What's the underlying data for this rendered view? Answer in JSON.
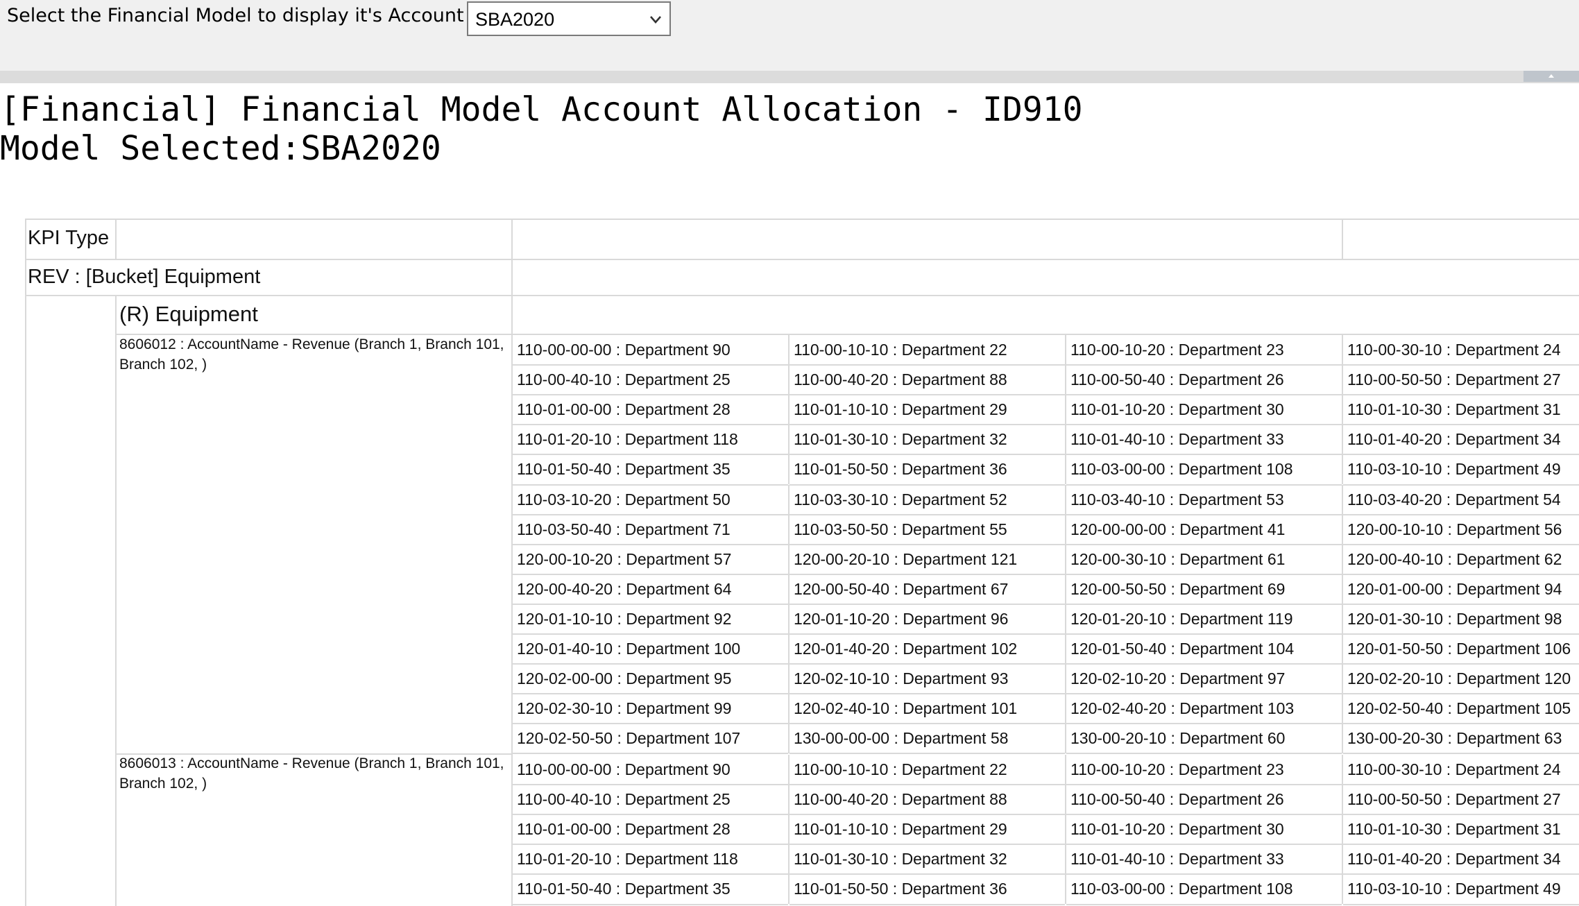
{
  "filter": {
    "label": "Select the Financial Model to display it's Account List",
    "selected": "SBA2020"
  },
  "title": "[Financial] Financial Model Account Allocation - ID910",
  "model_selected": "Model Selected:SBA2020",
  "table": {
    "kpi_label": "KPI Type",
    "bucket": "REV : [Bucket]  Equipment",
    "group": "(R) Equipment",
    "accounts": [
      {
        "name": "8606012 : AccountName - Revenue (Branch 1, Branch 101, Branch 102, )",
        "departments": [
          "110-00-00-00 : Department 90",
          "110-00-10-10 : Department 22",
          "110-00-10-20 : Department 23",
          "110-00-30-10 : Department 24",
          "110-00-40-10 : Department 25",
          "110-00-40-20 : Department 88",
          "110-00-50-40 : Department 26",
          "110-00-50-50 : Department 27",
          "110-01-00-00 : Department 28",
          "110-01-10-10 : Department 29",
          "110-01-10-20 : Department 30",
          "110-01-10-30 : Department 31",
          "110-01-20-10 : Department 118",
          "110-01-30-10 : Department 32",
          "110-01-40-10 : Department 33",
          "110-01-40-20 : Department 34",
          "110-01-50-40 : Department 35",
          "110-01-50-50 : Department 36",
          "110-03-00-00 : Department 108",
          "110-03-10-10 : Department 49",
          "110-03-10-20 : Department 50",
          "110-03-30-10 : Department 52",
          "110-03-40-10 : Department 53",
          "110-03-40-20 : Department 54",
          "110-03-50-40 : Department 71",
          "110-03-50-50 : Department 55",
          "120-00-00-00 : Department 41",
          "120-00-10-10 : Department 56",
          "120-00-10-20 : Department 57",
          "120-00-20-10 : Department 121",
          "120-00-30-10 : Department 61",
          "120-00-40-10 : Department 62",
          "120-00-40-20 : Department 64",
          "120-00-50-40 : Department 67",
          "120-00-50-50 : Department 69",
          "120-01-00-00 : Department 94",
          "120-01-10-10 : Department 92",
          "120-01-10-20 : Department 96",
          "120-01-20-10 : Department 119",
          "120-01-30-10 : Department 98",
          "120-01-40-10 : Department 100",
          "120-01-40-20 : Department 102",
          "120-01-50-40 : Department 104",
          "120-01-50-50 : Department 106",
          "120-02-00-00 : Department 95",
          "120-02-10-10 : Department 93",
          "120-02-10-20 : Department 97",
          "120-02-20-10 : Department 120",
          "120-02-30-10 : Department 99",
          "120-02-40-10 : Department 101",
          "120-02-40-20 : Department 103",
          "120-02-50-40 : Department 105",
          "120-02-50-50 : Department 107",
          "130-00-00-00 : Department 58",
          "130-00-20-10 : Department 60",
          "130-00-20-30 : Department 63"
        ]
      },
      {
        "name": "8606013 : AccountName - Revenue (Branch 1, Branch 101, Branch 102, )",
        "departments": [
          "110-00-00-00 : Department 90",
          "110-00-10-10 : Department 22",
          "110-00-10-20 : Department 23",
          "110-00-30-10 : Department 24",
          "110-00-40-10 : Department 25",
          "110-00-40-20 : Department 88",
          "110-00-50-40 : Department 26",
          "110-00-50-50 : Department 27",
          "110-01-00-00 : Department 28",
          "110-01-10-10 : Department 29",
          "110-01-10-20 : Department 30",
          "110-01-10-30 : Department 31",
          "110-01-20-10 : Department 118",
          "110-01-30-10 : Department 32",
          "110-01-40-10 : Department 33",
          "110-01-40-20 : Department 34",
          "110-01-50-40 : Department 35",
          "110-01-50-50 : Department 36",
          "110-03-00-00 : Department 108",
          "110-03-10-10 : Department 49"
        ]
      }
    ]
  }
}
